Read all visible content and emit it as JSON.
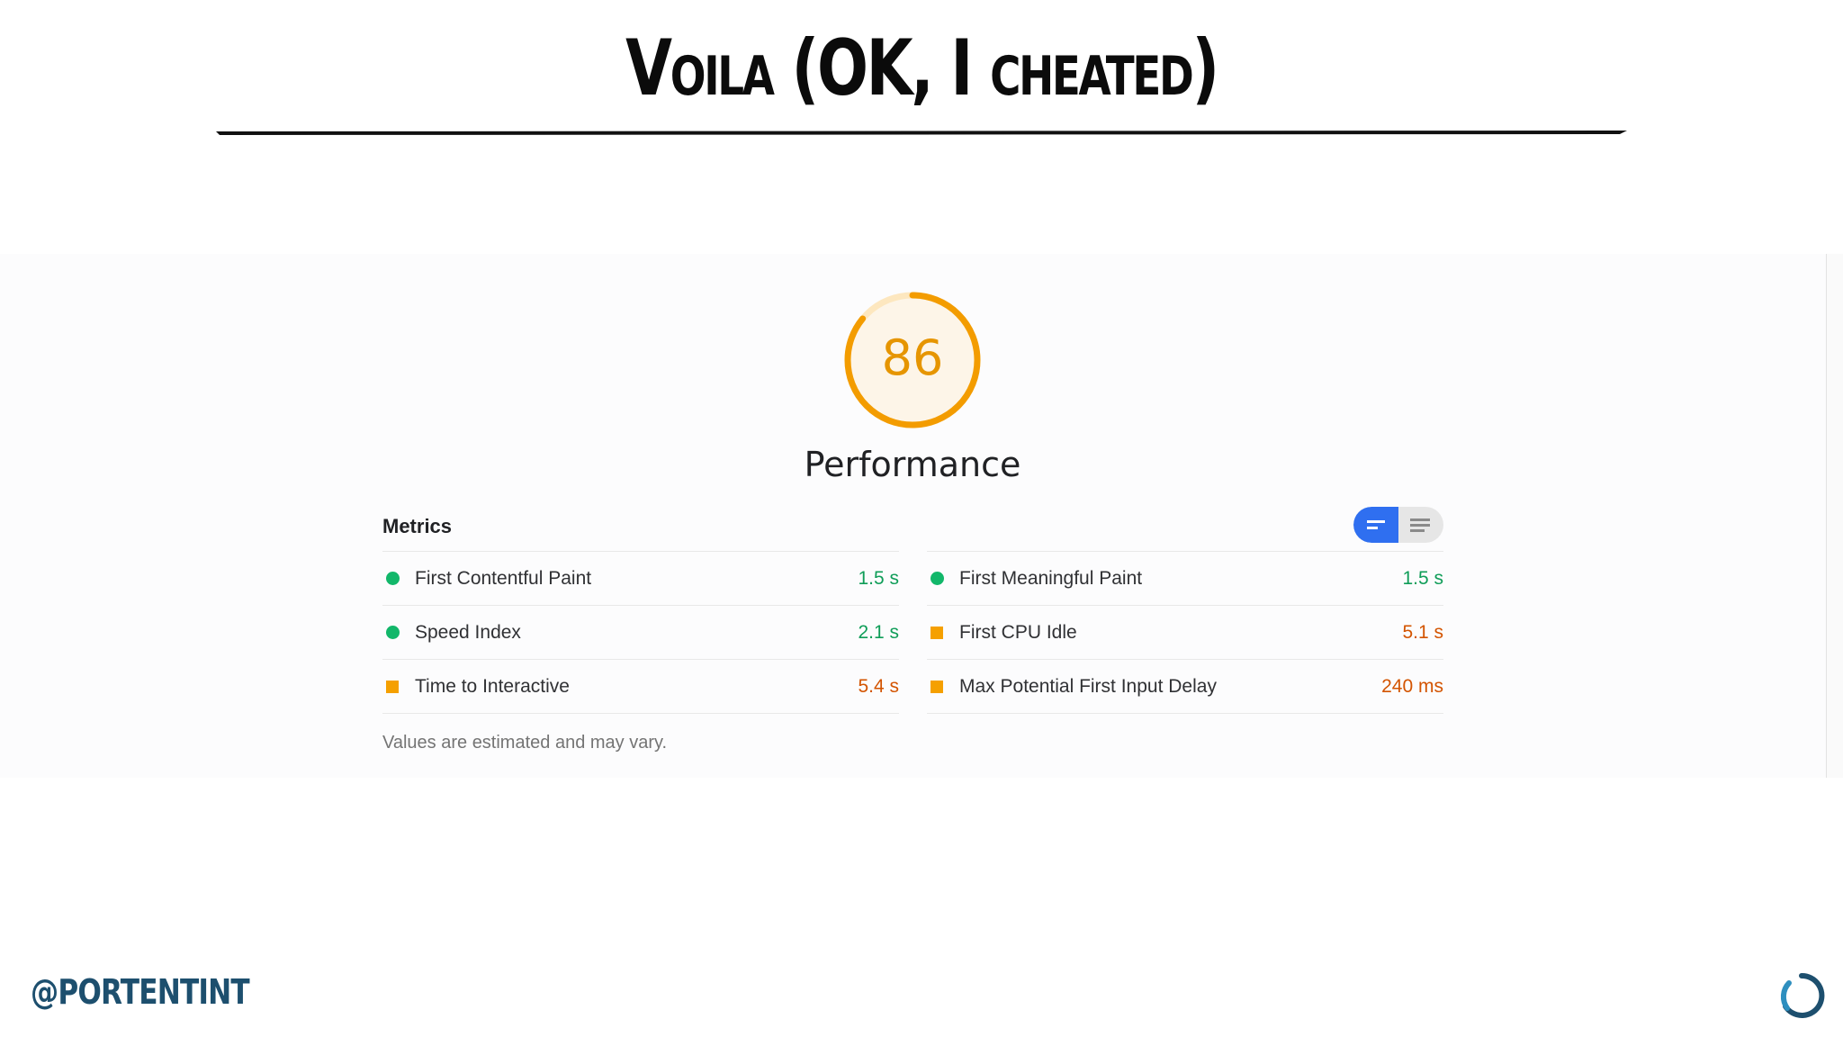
{
  "slide": {
    "title": "Voila (OK, I cheated)",
    "handle": "@PORTENTINT"
  },
  "report": {
    "score": "86",
    "score_fraction": 0.86,
    "category": "Performance",
    "metrics_header": "Metrics",
    "footnote": "Values are estimated and may vary.",
    "left_metrics": [
      {
        "name": "First Contentful Paint",
        "value": "1.5 s",
        "status": "pass"
      },
      {
        "name": "Speed Index",
        "value": "2.1 s",
        "status": "pass"
      },
      {
        "name": "Time to Interactive",
        "value": "5.4 s",
        "status": "average"
      }
    ],
    "right_metrics": [
      {
        "name": "First Meaningful Paint",
        "value": "1.5 s",
        "status": "pass"
      },
      {
        "name": "First CPU Idle",
        "value": "5.1 s",
        "status": "average"
      },
      {
        "name": "Max Potential First Input Delay",
        "value": "240 ms",
        "status": "average"
      }
    ]
  },
  "colors": {
    "gauge": "#f39c00",
    "gauge_track": "#fdeccd",
    "pass": "#12b76a",
    "average": "#f5a000",
    "toggle_active": "#2f6ff0",
    "handle": "#1d4f6e"
  },
  "icons": {
    "toggle_compact": "compact-view-icon",
    "toggle_expanded": "expanded-view-icon",
    "logo": "portent-logo-icon"
  }
}
